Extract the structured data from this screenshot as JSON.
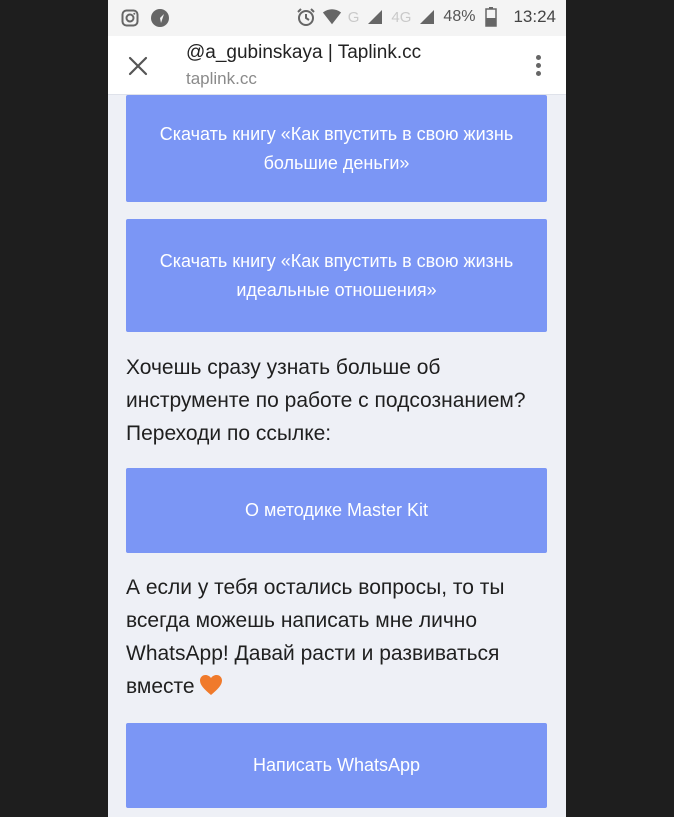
{
  "status_bar": {
    "icons_left": [
      "instagram-icon",
      "navigation-icon"
    ],
    "icons_right": [
      "alarm-icon",
      "wifi-icon"
    ],
    "network_label_1": "G",
    "network_label_2": "4G",
    "battery": "48%",
    "time": "13:24"
  },
  "browser": {
    "title": "@a_gubinskaya | Taplink.cc",
    "url": "taplink.cc"
  },
  "content": {
    "button_1": "Скачать книгу «Как впустить в свою жизнь большие деньги»",
    "button_2": "Скачать книгу «Как впустить в свою жизнь идеальные отношения»",
    "paragraph_1": "Хочешь сразу узнать больше об инструменте по работе с подсознанием? Переходи по ссылке:",
    "button_3": "О методике Master Kit",
    "paragraph_2": "А если у тебя остались вопросы, то ты всегда можешь написать мне лично WhatsApp! Давай расти и развиваться вместе",
    "button_4": "Написать WhatsApp"
  },
  "colors": {
    "button_bg": "#7b96f5",
    "page_bg": "#eef0f6",
    "heart": "#f07a2b"
  }
}
